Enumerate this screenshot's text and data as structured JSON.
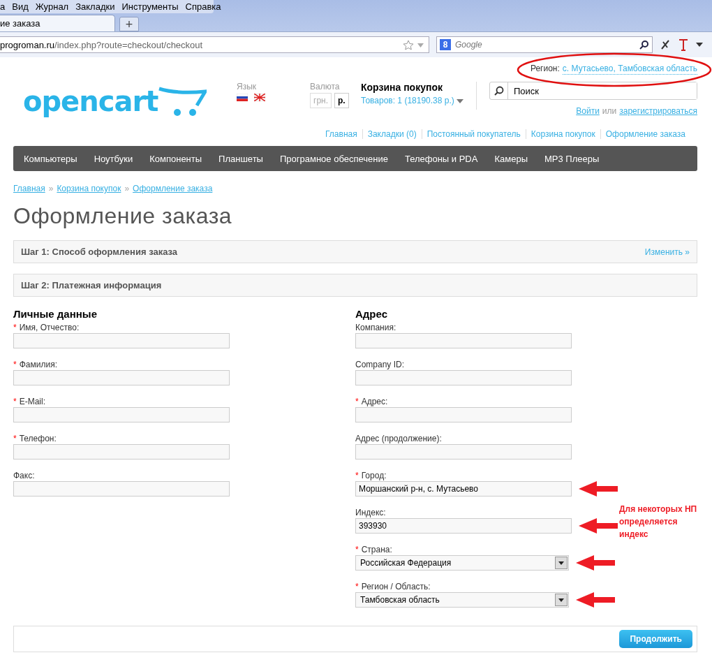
{
  "browser": {
    "menu_items": [
      "а",
      "Вид",
      "Журнал",
      "Закладки",
      "Инструменты",
      "Справка"
    ],
    "tab_title": "ие заказа",
    "new_tab": "+",
    "address_host": "progroman.ru",
    "address_path": "/index.php?route=checkout/checkout",
    "search_placeholder": "Google",
    "search_engine": "8"
  },
  "header": {
    "region_label": "Регион:",
    "region_value": "с. Мутасьево, Тамбовская область",
    "logo": "opencart",
    "language_label": "Язык",
    "currency_label": "Валюта",
    "currencies": [
      {
        "label": "грн.",
        "selected": false
      },
      {
        "label": "р.",
        "selected": true
      }
    ],
    "cart_title": "Корзина покупок",
    "cart_summary": "Товаров: 1 (18190.38 р.)",
    "search_placeholder": "Поиск",
    "login": "Войти",
    "or": "или",
    "register": "зарегистрироваться",
    "top_links": [
      "Главная",
      "Закладки (0)",
      "Постоянный покупатель",
      "Корзина покупок",
      "Оформление заказа"
    ]
  },
  "nav": [
    "Компьютеры",
    "Ноутбуки",
    "Компоненты",
    "Планшеты",
    "Програмное обеспечение",
    "Телефоны и PDA",
    "Камеры",
    "MP3 Плееры"
  ],
  "breadcrumbs": [
    {
      "label": "Главная"
    },
    {
      "separator": "»",
      "label": "Корзина покупок"
    },
    {
      "separator": "»",
      "label": "Оформление заказа"
    }
  ],
  "page_title": "Оформление заказа",
  "steps": [
    {
      "title": "Шаг 1: Способ оформления заказа",
      "action": "Изменить »"
    },
    {
      "title": "Шаг 2: Платежная информация"
    }
  ],
  "personal": {
    "heading": "Личные данные",
    "fields": [
      {
        "kind": "text",
        "required_mark": "*",
        "label": "Имя, Отчество:",
        "arrow": false
      },
      {
        "kind": "text",
        "required_mark": "*",
        "label": "Фамилия:",
        "arrow": false
      },
      {
        "kind": "text",
        "required_mark": "*",
        "label": "E-Mail:",
        "arrow": false
      },
      {
        "kind": "text",
        "required_mark": "*",
        "label": "Телефон:",
        "arrow": false
      },
      {
        "kind": "text",
        "label": "Факс:",
        "arrow": false
      }
    ]
  },
  "address": {
    "heading": "Адрес",
    "fields": [
      {
        "kind": "text",
        "label": "Компания:",
        "arrow": false
      },
      {
        "kind": "text",
        "label": "Company ID:",
        "arrow": false
      },
      {
        "kind": "text",
        "required_mark": "*",
        "label": "Адрес:",
        "arrow": false
      },
      {
        "kind": "text",
        "label": "Адрес (продолжение):",
        "arrow": false
      },
      {
        "kind": "text",
        "required_mark": "*",
        "label": "Город:",
        "value": "Моршанский р-н, с. Мутасьево",
        "arrow": true
      },
      {
        "kind": "text",
        "label": "Индекс:",
        "value": "393930",
        "arrow": true,
        "note": "Для некоторых НП определяется индекс"
      },
      {
        "kind": "select",
        "required_mark": "*",
        "label": "Страна:",
        "value": "Российская Федерация",
        "arrow": true
      },
      {
        "kind": "select",
        "required_mark": "*",
        "label": "Регион / Область:",
        "value": "Тамбовская область",
        "arrow": true
      }
    ]
  },
  "continue_button": "Продолжить"
}
